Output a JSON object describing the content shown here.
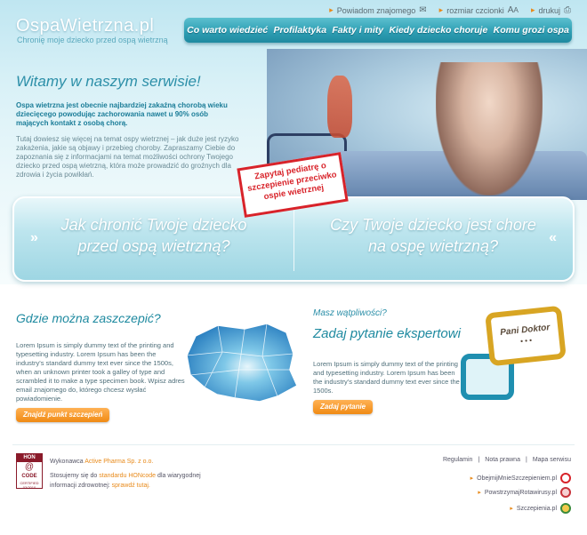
{
  "header": {
    "logo": "OspaWietrzna.pl",
    "tagline": "Chronię moje dziecko przed ospą wietrzną",
    "toplinks": [
      {
        "label": "Powiadom znajomego",
        "icon": "envelope-icon"
      },
      {
        "label": "rozmiar czcionki",
        "icon": "font-size-icon"
      },
      {
        "label": "drukuj",
        "icon": "printer-icon"
      }
    ],
    "nav": [
      "Co warto wiedzieć",
      "Profilaktyka",
      "Fakty i mity",
      "Kiedy dziecko choruje",
      "Komu grozi ospa"
    ]
  },
  "hero": {
    "welcome": "Witamy w naszym serwisie!",
    "intro_bold": "Ospa wietrzna jest obecnie najbardziej zakaźną chorobą wieku dziecięcego powodując zachorowania nawet u 90% osób mających kontakt z osobą chorą.",
    "intro": "Tutaj dowiesz się więcej na temat ospy wietrznej – jak duże jest ryzyko zakażenia, jakie są objawy i przebieg choroby. Zapraszamy Ciebie do zapoznania się z informacjami na temat możliwości ochrony Twojego dziecko przed ospą wietrzną, która może prowadzić do groźnych dla zdrowia i życia powikłań.",
    "stamp": "Zapytaj pediatrę o szczepienie przeciwko ospie wietrznej"
  },
  "banner": {
    "left": "Jak chronić Twoje dziecko przed ospą wietrzną?",
    "right": "Czy Twoje dziecko jest chore na ospę wietrzną?"
  },
  "vaccinate": {
    "title": "Gdzie można zaszczepić?",
    "text": "Lorem Ipsum is simply dummy text of the printing and typesetting industry. Lorem Ipsum has been the industry's standard dummy text ever since the 1500s, when an unknown printer took a galley of type and scrambled it to make a type specimen book. Wpisz adres email znajomego do, którego chcesz wysłać powiadomienie.",
    "button": "Znajdź punkt szczepień"
  },
  "expert": {
    "kicker": "Masz wątpliwości?",
    "title": "Zadaj pytanie ekspertowi",
    "text": "Lorem Ipsum is simply dummy text of the printing and typesetting industry. Lorem Ipsum has been the industry's standard dummy text ever since the 1500s.",
    "button": "Zadaj pytanie",
    "bubble": "Pani Doktor",
    "bubble_dots": "• • •"
  },
  "footer": {
    "hon_top": "HON",
    "hon_mid": "CODE",
    "hon_bottom": "CERTIFIED 03/2010",
    "producer_prefix": "Wykonawca",
    "producer": "Active Pharma Sp. z o.o.",
    "hon_text_1": "Stosujemy się do",
    "hon_link": "standardu HONcode",
    "hon_text_2": "dla wiarygodnej informacji zdrowotnej:",
    "hon_verify": "sprawdź tutaj.",
    "links": [
      "Regulamin",
      "Nota prawna",
      "Mapa serwisu"
    ],
    "partners": [
      "ObejmijMnieSzczepieniem.pl",
      "PowstrzymajRotawirusy.pl",
      "Szczepienia.pl"
    ]
  }
}
